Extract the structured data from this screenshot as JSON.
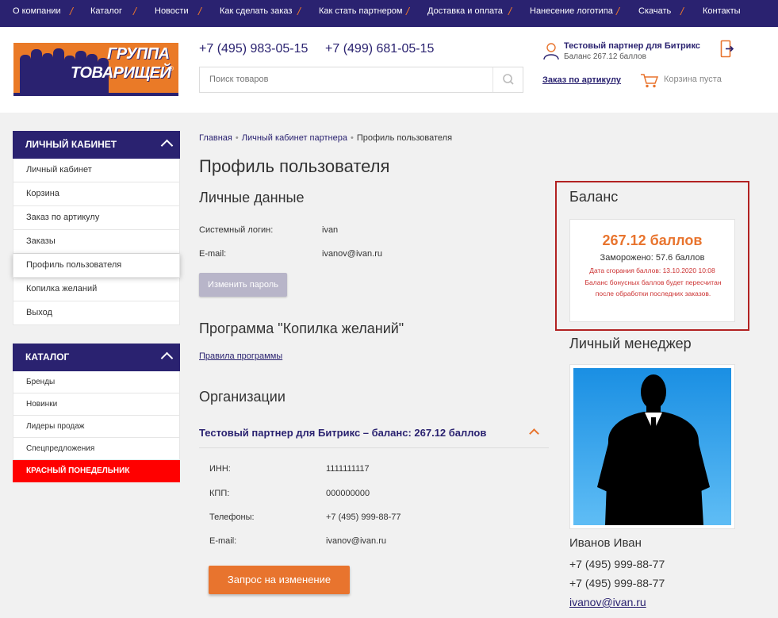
{
  "topnav": [
    {
      "label": "О компании"
    },
    {
      "label": "Каталог"
    },
    {
      "label": "Новости"
    },
    {
      "label": "Как сделать заказ"
    },
    {
      "label": "Как стать партнером"
    },
    {
      "label": "Доставка и оплата"
    },
    {
      "label": "Нанесение логотипа"
    },
    {
      "label": "Скачать"
    },
    {
      "label": "Контакты"
    }
  ],
  "header": {
    "logo_line1": "ГРУППА",
    "logo_line2": "ТОВАРИЩЕЙ",
    "logo_reg": "®",
    "phone1": "+7 (495) 983-05-15",
    "phone2": "+7 (499) 681-05-15",
    "search_placeholder": "Поиск товаров",
    "user_name": "Тестовый партнер для Битрикс",
    "user_balance": "Баланс 267.12 баллов",
    "order_by_article": "Заказ по артикулу",
    "cart_text": "Корзина пуста"
  },
  "sidebar": {
    "cabinet_title": "ЛИЧНЫЙ КАБИНЕТ",
    "cabinet_items": [
      {
        "label": "Личный кабинет"
      },
      {
        "label": "Корзина"
      },
      {
        "label": "Заказ по артикулу"
      },
      {
        "label": "Заказы"
      },
      {
        "label": "Профиль пользователя"
      },
      {
        "label": "Копилка желаний"
      },
      {
        "label": "Выход"
      }
    ],
    "catalog_title": "КАТАЛОГ",
    "catalog_items": [
      {
        "label": "Бренды"
      },
      {
        "label": "Новинки"
      },
      {
        "label": "Лидеры продаж"
      },
      {
        "label": "Спецпредложения"
      },
      {
        "label": "КРАСНЫЙ ПОНЕДЕЛЬНИК"
      }
    ]
  },
  "breadcrumb": {
    "home": "Главная",
    "partner": "Личный кабинет партнера",
    "current": "Профиль пользователя"
  },
  "main": {
    "title": "Профиль пользователя",
    "personal_title": "Личные данные",
    "login_label": "Системный логин:",
    "login_value": "ivan",
    "email_label": "E-mail:",
    "email_value": "ivanov@ivan.ru",
    "change_password": "Изменить пароль",
    "program_title": "Программа \"Копилка желаний\"",
    "program_rules": "Правила программы",
    "orgs_title": "Организации",
    "org_name": "Тестовый партнер для Битрикс – баланс: 267.12 баллов",
    "org_fields": [
      {
        "label": "ИНН:",
        "value": "1111111117"
      },
      {
        "label": "КПП:",
        "value": "000000000"
      },
      {
        "label": "Телефоны:",
        "value": "+7 (495) 999-88-77"
      },
      {
        "label": "E-mail:",
        "value": "ivanov@ivan.ru"
      }
    ],
    "request_change": "Запрос на изменение"
  },
  "balance": {
    "title": "Баланс",
    "amount": "267.12 баллов",
    "frozen": "Заморожено: 57.6 баллов",
    "expiry": "Дата сгорания баллов: 13.10.2020 10:08",
    "note": "Баланс бонусных баллов будет пересчитан после обработки последних заказов."
  },
  "manager": {
    "title": "Личный менеджер",
    "name": "Иванов Иван",
    "phone1": "+7 (495) 999-88-77",
    "phone2": "+7 (495) 999-88-77",
    "email": "ivanov@ivan.ru"
  },
  "colors": {
    "brand": "#2a2270",
    "accent": "#e8742e",
    "highlight_frame": "#b22222",
    "promo": "#ff0000"
  }
}
